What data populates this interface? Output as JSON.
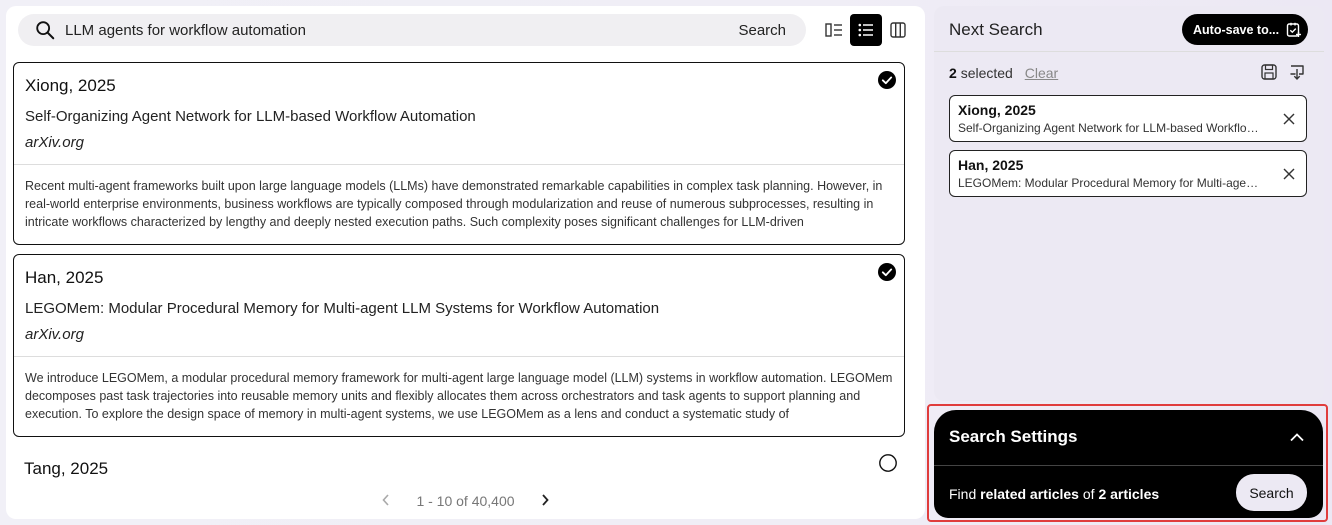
{
  "search": {
    "query": "LLM agents for workflow automation",
    "button_label": "Search"
  },
  "view_toggles": [
    {
      "name": "compact-view-icon",
      "active": false
    },
    {
      "name": "list-view-icon",
      "active": true
    },
    {
      "name": "columns-view-icon",
      "active": false
    }
  ],
  "results": [
    {
      "author": "Xiong, 2025",
      "title": "Self-Organizing Agent Network for LLM-based Workflow Automation",
      "venue": "arXiv.org",
      "abstract": "Recent multi-agent frameworks built upon large language models (LLMs) have demonstrated remarkable capabilities in complex task planning. However, in real-world enterprise environments, business workflows are typically composed through modularization and reuse of numerous subprocesses, resulting in intricate workflows characterized by lengthy and deeply nested execution paths. Such complexity poses significant challenges for LLM-driven",
      "selected": true
    },
    {
      "author": "Han, 2025",
      "title": "LEGOMem: Modular Procedural Memory for Multi-agent LLM Systems for Workflow Automation",
      "venue": "arXiv.org",
      "abstract": "We introduce LEGOMem, a modular procedural memory framework for multi-agent large language model (LLM) systems in workflow automation. LEGOMem decomposes past task trajectories into reusable memory units and flexibly allocates them across orchestrators and task agents to support planning and execution. To explore the design space of memory in multi-agent systems, we use LEGOMem as a lens and conduct a systematic study of",
      "selected": true
    },
    {
      "author": "Tang, 2025",
      "selected": false
    }
  ],
  "pager": {
    "range": "1 - 10 of 40,400"
  },
  "next_search": {
    "title": "Next Search",
    "autosave_label": "Auto-save to...",
    "selected_count": "2",
    "selected_suffix": "selected",
    "clear_label": "Clear",
    "chips": [
      {
        "author": "Xiong, 2025",
        "title": "Self-Organizing Agent Network for LLM-based Workflow Automation"
      },
      {
        "author": "Han, 2025",
        "title": "LEGOMem: Modular Procedural Memory for Multi-agent LLM Systems for Workflow Automation"
      }
    ]
  },
  "settings": {
    "title": "Search Settings",
    "find_prefix": "Find",
    "find_related": "related articles",
    "find_of": "of",
    "find_count": "2 articles",
    "search_label": "Search"
  }
}
